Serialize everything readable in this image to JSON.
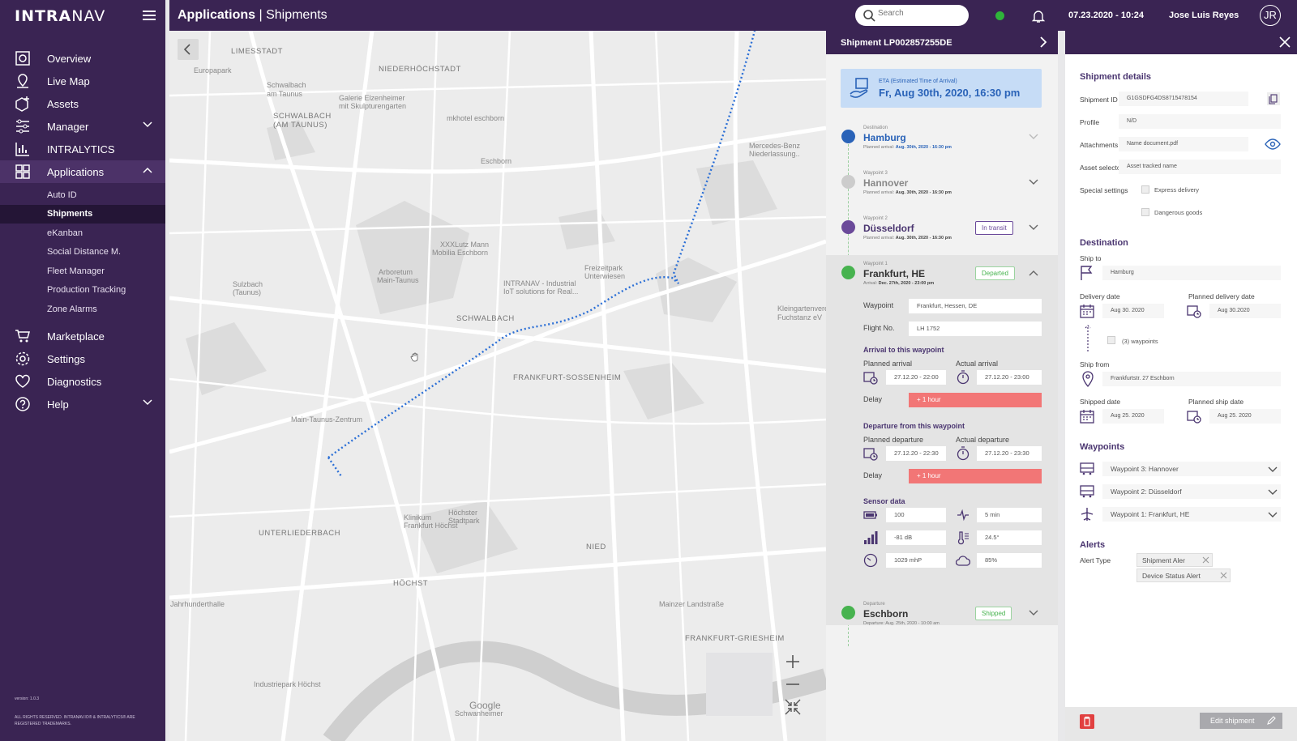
{
  "brand": {
    "logo_bold": "INTRA",
    "logo_light": "NAV"
  },
  "sidebar": {
    "items": [
      {
        "label": "Overview"
      },
      {
        "label": "Live Map"
      },
      {
        "label": "Assets"
      },
      {
        "label": "Manager"
      },
      {
        "label": "INTRALYTICS"
      },
      {
        "label": "Applications"
      },
      {
        "label": "Marketplace"
      },
      {
        "label": "Settings"
      },
      {
        "label": "Diagnostics"
      },
      {
        "label": "Help"
      }
    ],
    "sub_items": [
      "Auto ID",
      "Shipments",
      "eKanban",
      "Social Distance M.",
      "Fleet Manager",
      "Production Tracking",
      "Zone Alarms"
    ],
    "version": "version: 1.0.3",
    "copyright": "ALL RIGHTS RESERVED. INTRANAV.IO® & INTRALYTICS® ARE REGISTERED TRADEMARKS."
  },
  "topbar": {
    "section": "Applications",
    "separator": "|",
    "page": "Shipments",
    "search_placeholder": "Search",
    "datetime": "07.23.2020 - 10:24",
    "user": "Jose Luis Reyes",
    "initials": "JR"
  },
  "map": {
    "labels": [
      "LIMESSTADT",
      "NIEDERHÖCHSTADT",
      "Europapark",
      "Schwalbach",
      "am Taunus",
      "SCHWALBACH",
      "(AM TAUNUS)",
      "Galerie Elzenheimer",
      "mit Skulpturengarten",
      "mkhotel eschborn",
      "Eschborn",
      "Mercedes-Benz",
      "Niederlassung..",
      "XXXLutz Mann",
      "Mobilia Eschborn",
      "Arboretum",
      "Main-Taunus",
      "Freizeitpark",
      "Unterwiesen",
      "INTRANAV - Industrial",
      "IoT solutions for Real...",
      "Sulzbach",
      "(Taunus)",
      "SCHWALBACH",
      "FRANKFURT-SOSSENHEIM",
      "Kleingartenvere",
      "Fuchstanz eV",
      "Main-Taunus-Zentrum",
      "Klinikum",
      "Frankfurt Höchst",
      "Höchster",
      "Stadtpark",
      "UNTERLIEDERBACH",
      "NIED",
      "HÖCHST",
      "Jahrhunderthalle",
      "Mainzer Landstraße",
      "FRANKFURT-GRIESHEIM",
      "Industriepark Höchst",
      "Google",
      "Schwanheimer"
    ]
  },
  "shipment": {
    "title": "Shipment LP002857255DE",
    "eta_label": "ETA (Estimated Time of Arrival)",
    "eta_value": "Fr, Aug 30th, 2020, 16:30 pm",
    "waypoints": [
      {
        "tag": "Destination",
        "name": "Hamburg",
        "sub_label": "Planned arrival:",
        "sub_value": "Aug. 30th, 2020 - 16:30 pm"
      },
      {
        "tag": "Waypoint 3",
        "name": "Hannover",
        "sub_label": "Planned arrival:",
        "sub_value": "Aug. 30th, 2020 - 16:30 pm"
      },
      {
        "tag": "Waypoint 2",
        "name": "Düsseldorf",
        "sub_label": "Planned arrival:",
        "sub_value": "Aug. 30th, 2020 - 16:30 pm",
        "badge": "In transit"
      },
      {
        "tag": "Waypoint 1",
        "name": "Frankfurt, HE",
        "sub_label": "Arrival:",
        "sub_value": "Dec. 27th, 2020 - 23:00 pm",
        "badge": "Departed"
      },
      {
        "tag": "Departure",
        "name": "Eschborn",
        "sub_label": "Departure:",
        "sub_value": "Aug. 25th, 2020 - 10:00 am",
        "badge": "Shipped"
      }
    ],
    "expanded": {
      "waypoint_label": "Waypoint",
      "waypoint_value": "Frankfurt, Hessen, DE",
      "flight_label": "Flight No.",
      "flight_value": "LH 1752",
      "arrival_section": "Arrival to this waypoint",
      "planned_arrival_label": "Planned arrival",
      "planned_arrival": "27.12.20 - 22:00",
      "actual_arrival_label": "Actual arrival",
      "actual_arrival": "27.12.20 - 23:00",
      "delay_label": "Delay",
      "arrival_delay": "+ 1 hour",
      "departure_section": "Departure from this waypoint",
      "planned_departure_label": "Planned departure",
      "planned_departure": "27.12.20 - 22:30",
      "actual_departure_label": "Actual departure",
      "actual_departure": "27.12.20 - 23:30",
      "departure_delay": "+ 1 hour",
      "sensor_section": "Sensor data",
      "sensors": {
        "battery": "100",
        "interval": "5 min",
        "signal": "-81 dB",
        "temperature": "24.5°",
        "pressure": "1029 mhP",
        "humidity": "85%"
      }
    }
  },
  "details": {
    "heading": "Shipment details",
    "shipment_id_label": "Shipment ID",
    "shipment_id": "G1GSDFG4DS8715478154",
    "profile_label": "Profile",
    "profile": "N/D",
    "attachments_label": "Attachments",
    "attachment": "Name document.pdf",
    "asset_selector_label": "Asset selector",
    "asset_selector": "Asset tracked name",
    "special_label": "Special settings",
    "express": "Express delivery",
    "dangerous": "Dangerous goods",
    "destination_heading": "Destination",
    "ship_to_label": "Ship to",
    "ship_to": "Hamburg",
    "delivery_date_label": "Delivery date",
    "delivery_date": "Aug 30. 2020",
    "planned_delivery_label": "Planned delivery date",
    "planned_delivery": "Aug 30.2020",
    "waypoints_count": "(3) waypoints",
    "ship_from_label": "Ship from",
    "ship_from": "Frankfurtstr. 27 Eschborn",
    "shipped_date_label": "Shipped date",
    "shipped_date": "Aug 25. 2020",
    "planned_ship_label": "Planned ship date",
    "planned_ship": "Aug 25. 2020",
    "waypoints_heading": "Waypoints",
    "waypoints": [
      "Waypoint 3: Hannover",
      "Waypoint 2: Düsseldorf",
      "Waypoint 1: Frankfurt, HE"
    ],
    "alerts_heading": "Alerts",
    "alert_type_label": "Alert Type",
    "alerts": [
      "Shipment Aler",
      "Device Status Alert"
    ],
    "edit_button": "Edit shipment"
  },
  "colors": {
    "brand": "#3a2453",
    "accent_blue": "#2a63b8",
    "delay_red": "#f27676",
    "transit_purple": "#6b4a9a",
    "departed_green": "#47b34f",
    "route_blue": "#2b6fd6"
  }
}
